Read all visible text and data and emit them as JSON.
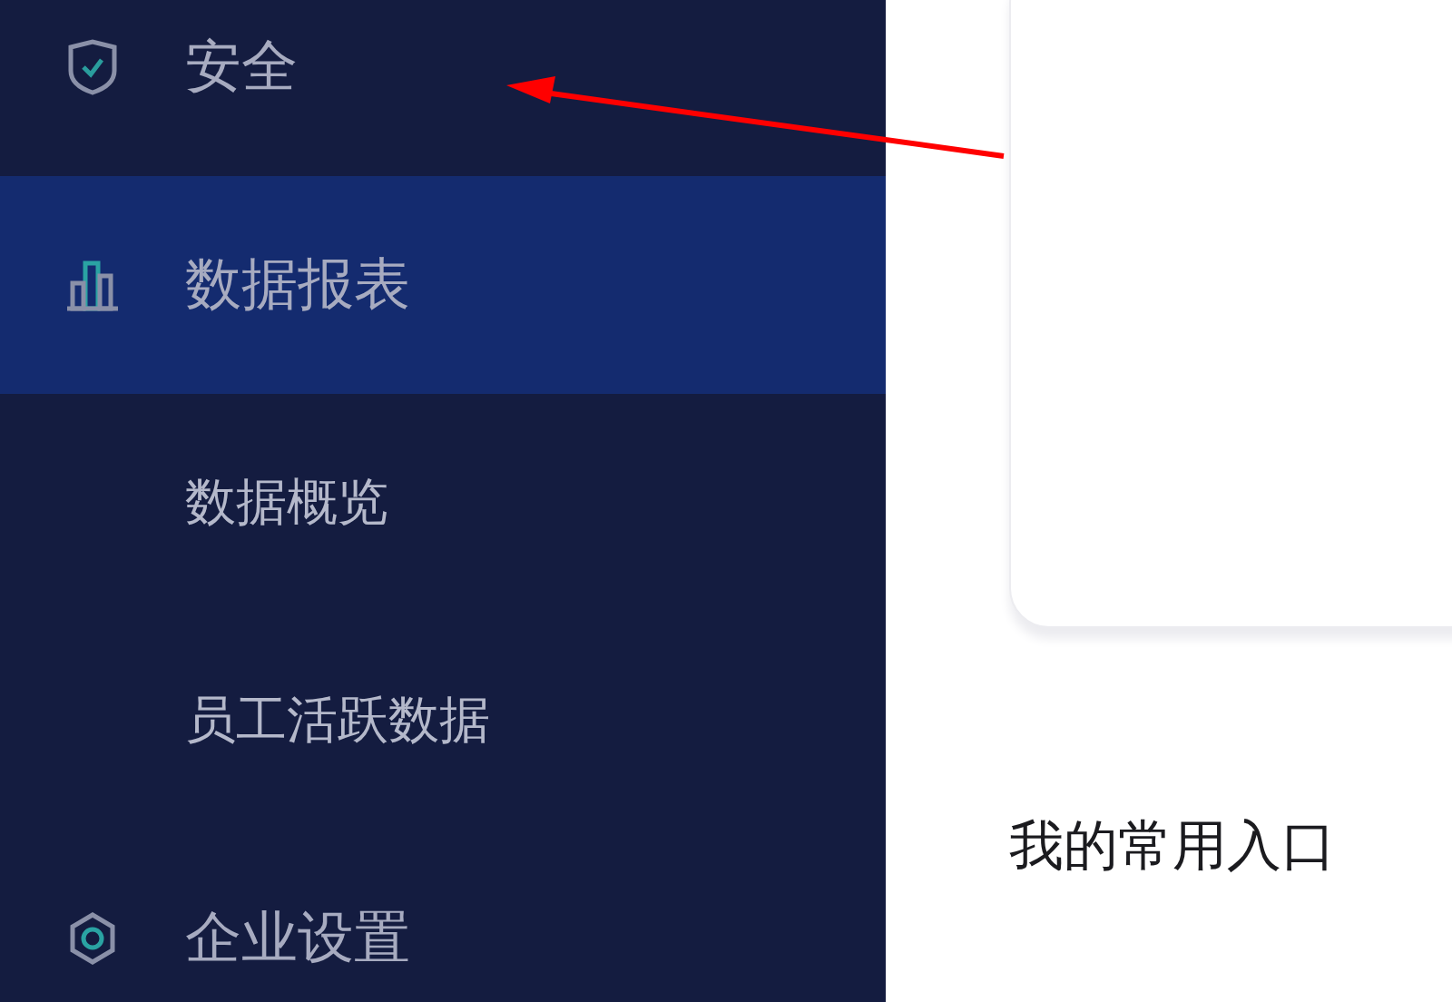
{
  "sidebar": {
    "items": [
      {
        "label": "安全",
        "selected": false
      },
      {
        "label": "数据报表",
        "selected": true,
        "children": [
          {
            "label": "数据概览",
            "selected": false
          },
          {
            "label": "员工活跃数据",
            "selected": false
          }
        ]
      },
      {
        "label": "企业设置",
        "selected": false
      }
    ]
  },
  "main": {
    "section_title": "我的常用入口"
  },
  "annotation": {
    "kind": "arrow",
    "color": "#ff0000"
  }
}
